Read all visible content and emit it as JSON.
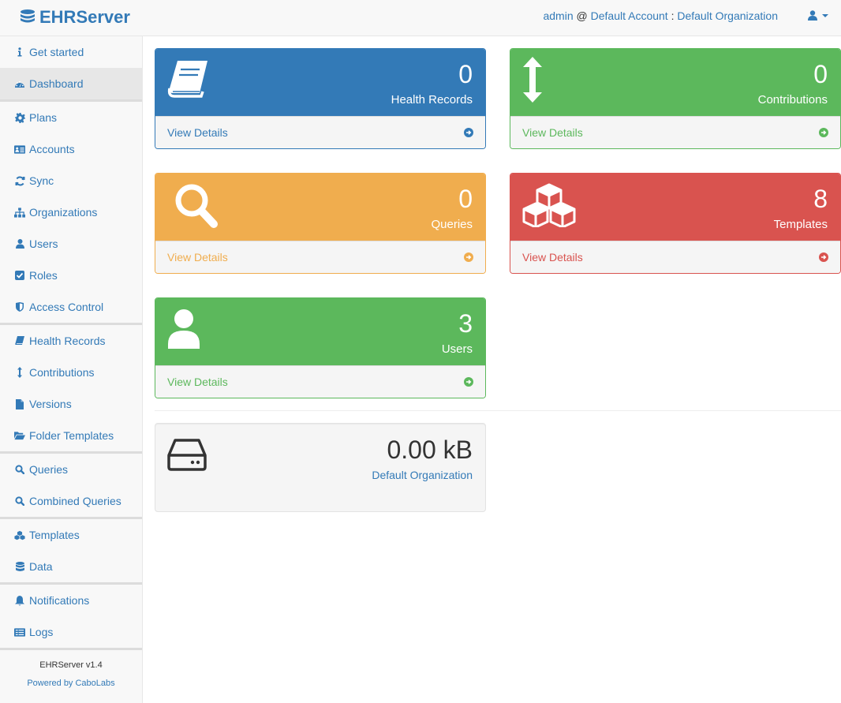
{
  "brand": {
    "name": "EHRServer"
  },
  "header": {
    "user": "admin",
    "at": "@",
    "account": "Default Account",
    "colon": ":",
    "organization": "Default Organization"
  },
  "sidebar": {
    "items": [
      {
        "label": "Get started",
        "icon": "info-icon"
      },
      {
        "label": "Dashboard",
        "icon": "dashboard-icon",
        "active": true
      },
      {
        "label": "Plans",
        "icon": "gear-icon"
      },
      {
        "label": "Accounts",
        "icon": "id-card-icon"
      },
      {
        "label": "Sync",
        "icon": "refresh-icon"
      },
      {
        "label": "Organizations",
        "icon": "sitemap-icon"
      },
      {
        "label": "Users",
        "icon": "user-icon"
      },
      {
        "label": "Roles",
        "icon": "check-square-icon"
      },
      {
        "label": "Access Control",
        "icon": "shield-icon"
      },
      {
        "label": "Health Records",
        "icon": "book-icon"
      },
      {
        "label": "Contributions",
        "icon": "arrows-v-icon"
      },
      {
        "label": "Versions",
        "icon": "file-icon"
      },
      {
        "label": "Folder Templates",
        "icon": "folder-open-icon"
      },
      {
        "label": "Queries",
        "icon": "search-icon"
      },
      {
        "label": "Combined Queries",
        "icon": "search-icon"
      },
      {
        "label": "Templates",
        "icon": "cubes-icon"
      },
      {
        "label": "Data",
        "icon": "database-icon"
      },
      {
        "label": "Notifications",
        "icon": "bell-icon"
      },
      {
        "label": "Logs",
        "icon": "list-icon"
      }
    ],
    "footer": {
      "version": "EHRServer v1.4",
      "powered": "Powered by CaboLabs"
    }
  },
  "panels": {
    "health_records": {
      "count": "0",
      "label": "Health Records",
      "link": "View Details"
    },
    "contributions": {
      "count": "0",
      "label": "Contributions",
      "link": "View Details"
    },
    "queries": {
      "count": "0",
      "label": "Queries",
      "link": "View Details"
    },
    "templates": {
      "count": "8",
      "label": "Templates",
      "link": "View Details"
    },
    "users": {
      "count": "3",
      "label": "Users",
      "link": "View Details"
    }
  },
  "storage": {
    "size": "0.00 kB",
    "organization": "Default Organization"
  },
  "colors": {
    "primary": "#337ab7",
    "success": "#5cb85c",
    "warning": "#f0ad4e",
    "danger": "#d9534f"
  }
}
